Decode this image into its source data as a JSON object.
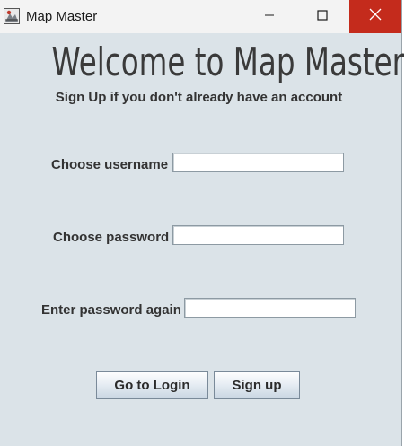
{
  "window": {
    "title": "Map Master",
    "icon": "map-app-icon",
    "controls": {
      "minimize": "minimize-icon",
      "maximize": "maximize-icon",
      "close": "close-icon"
    },
    "close_color": "#c42b1c"
  },
  "heading": "Welcome to Map Master!",
  "subtitle": "Sign Up if you don't already have an account",
  "form": {
    "username_label": "Choose username",
    "username_value": "",
    "password_label": "Choose password",
    "password_value": "",
    "confirm_label": "Enter password again",
    "confirm_value": ""
  },
  "buttons": {
    "login": "Go to Login",
    "signup": "Sign up"
  },
  "colors": {
    "background": "#dbe3e8",
    "text": "#333333"
  }
}
